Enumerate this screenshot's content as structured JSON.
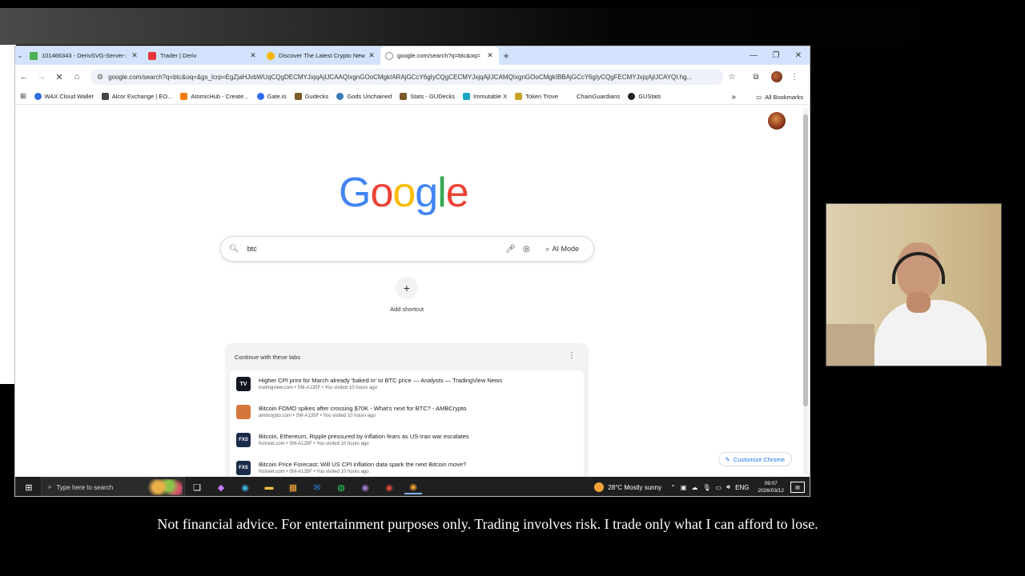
{
  "browser": {
    "tabs": [
      {
        "label": "101466343 - DerivSVG-Server-:",
        "favicon_color": "#4caf50",
        "active": false
      },
      {
        "label": "Trader | Deriv",
        "favicon_color": "#e53935",
        "active": false
      },
      {
        "label": "Discover The Latest Crypto New",
        "favicon_color": "#f4b400",
        "active": false
      },
      {
        "label": "google.com/search?q=btc&oq=",
        "favicon_color": "#888888",
        "active": true
      }
    ],
    "url": "google.com/search?q=btc&oq=&gs_lcrp=EgZjaHJvbWUqCQgDECMYJxjqAjIJCAAQIxgnGOoCMgkIARAjGCcY6gIyCQgCECMYJxjqAjIJCAMQIxgnGOoCMgkIBBAjGCcY6gIyCQgFECMYJxjqAjIJCAYQI.hg...",
    "bookmarks": [
      {
        "label": "WAX Cloud Wallet",
        "color": "#2a6fdb"
      },
      {
        "label": "Alcor Exchange | EO...",
        "color": "#444444"
      },
      {
        "label": "AtomicHub - Create...",
        "color": "#f57c00"
      },
      {
        "label": "Gate.io",
        "color": "#2d6df6"
      },
      {
        "label": "Gudecks",
        "color": "#7a5a2a"
      },
      {
        "label": "Gods Unchained",
        "color": "#3a7ab8"
      },
      {
        "label": "Stats - GUDecks",
        "color": "#7a5a2a"
      },
      {
        "label": "Immutable X",
        "color": "#1aa7c4"
      },
      {
        "label": "Token Trove",
        "color": "#c9a227"
      },
      {
        "label": "ChainGuardians",
        "color": "#ffffff"
      },
      {
        "label": "GUStats",
        "color": "#222222"
      }
    ],
    "all_bookmarks": "All Bookmarks"
  },
  "page": {
    "logo_letters": [
      {
        "ch": "G",
        "color": "#4285F4"
      },
      {
        "ch": "o",
        "color": "#EA4335"
      },
      {
        "ch": "o",
        "color": "#FBBC05"
      },
      {
        "ch": "g",
        "color": "#4285F4"
      },
      {
        "ch": "l",
        "color": "#34A853"
      },
      {
        "ch": "e",
        "color": "#EA4335"
      }
    ],
    "search_value": "btc",
    "ai_mode": "AI Mode",
    "add_shortcut": "Add shortcut",
    "continue_title": "Continue with these tabs",
    "continue_items": [
      {
        "icon": "TV",
        "icon_color": "#131722",
        "title": "Higher CPI print for March already 'baked in' to BTC price — Analysts — TradingView News",
        "meta": "tradingview.com • SM-A135F • You visited 10 hours ago"
      },
      {
        "icon": "",
        "icon_color": "#d4773a",
        "title": "Bitcoin FOMO spikes after crossing $70K - What's next for BTC? - AMBCrypto",
        "meta": "ambcrypto.com • SM-A135F • You visited 10 hours ago"
      },
      {
        "icon": "FXS",
        "icon_color": "#1c2a4a",
        "title": "Bitcoin, Ethereum, Ripple pressured by inflation fears as US-Iran war escalates",
        "meta": "fxstreet.com • SM-A135F • You visited 10 hours ago"
      },
      {
        "icon": "FXS",
        "icon_color": "#1c2a4a",
        "title": "Bitcoin Price Forecast: Will US CPI inflation data spark the next Bitcoin move?",
        "meta": "fxstreet.com • SM-A135F • You visited 10 hours ago"
      }
    ],
    "customize": "Customize Chrome"
  },
  "taskbar": {
    "search_hint": "Type here to search",
    "weather": "28°C  Mostly sunny",
    "lang": "ENG",
    "time": "09:07",
    "date": "2026/03/12"
  },
  "disclaimer": "Not financial advice. For entertainment purposes only. Trading involves risk. I trade only what I can afford to lose."
}
